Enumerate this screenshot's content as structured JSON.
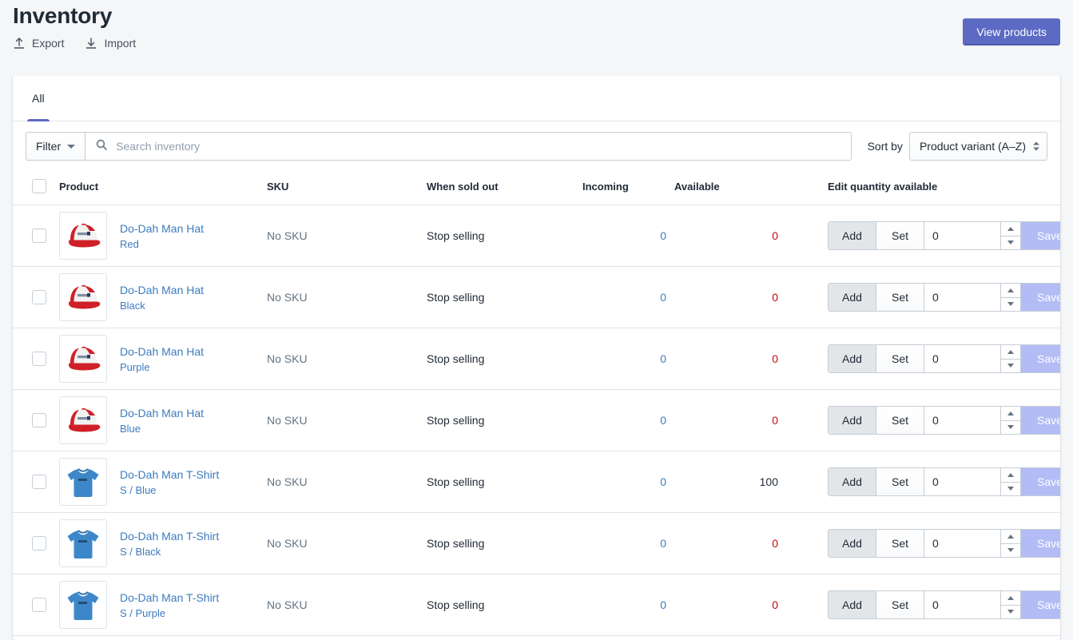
{
  "header": {
    "title": "Inventory",
    "export_label": "Export",
    "import_label": "Import",
    "export_icon": "upload-arrow-icon",
    "import_icon": "download-arrow-icon",
    "view_products_label": "View products"
  },
  "tabs": [
    {
      "label": "All",
      "active": true
    }
  ],
  "toolbar": {
    "filter_label": "Filter",
    "search_placeholder": "Search inventory",
    "search_value": "",
    "search_icon": "search-icon",
    "sort_label": "Sort by",
    "sort_value": "Product variant (A–Z)",
    "sort_options": [
      "Product variant (A–Z)"
    ]
  },
  "table": {
    "columns": [
      "",
      "Product",
      "SKU",
      "When sold out",
      "Incoming",
      "Available",
      "Edit quantity available"
    ],
    "rows": [
      {
        "selected": false,
        "thumb": "red-trucker-hat-icon",
        "product": "Do-Dah Man Hat",
        "variant": "Red",
        "sku": "No SKU",
        "when_sold_out": "Stop selling",
        "incoming": "0",
        "available": "0",
        "available_zero": true,
        "add_label": "Add",
        "set_label": "Set",
        "qty_value": "0",
        "save_label": "Save"
      },
      {
        "selected": false,
        "thumb": "red-trucker-hat-icon",
        "product": "Do-Dah Man Hat",
        "variant": "Black",
        "sku": "No SKU",
        "when_sold_out": "Stop selling",
        "incoming": "0",
        "available": "0",
        "available_zero": true,
        "add_label": "Add",
        "set_label": "Set",
        "qty_value": "0",
        "save_label": "Save"
      },
      {
        "selected": false,
        "thumb": "red-trucker-hat-icon",
        "product": "Do-Dah Man Hat",
        "variant": "Purple",
        "sku": "No SKU",
        "when_sold_out": "Stop selling",
        "incoming": "0",
        "available": "0",
        "available_zero": true,
        "add_label": "Add",
        "set_label": "Set",
        "qty_value": "0",
        "save_label": "Save"
      },
      {
        "selected": false,
        "thumb": "red-trucker-hat-icon",
        "product": "Do-Dah Man Hat",
        "variant": "Blue",
        "sku": "No SKU",
        "when_sold_out": "Stop selling",
        "incoming": "0",
        "available": "0",
        "available_zero": true,
        "add_label": "Add",
        "set_label": "Set",
        "qty_value": "0",
        "save_label": "Save"
      },
      {
        "selected": false,
        "thumb": "blue-tshirt-icon",
        "product": "Do-Dah Man T-Shirt",
        "variant": "S / Blue",
        "sku": "No SKU",
        "when_sold_out": "Stop selling",
        "incoming": "0",
        "available": "100",
        "available_zero": false,
        "add_label": "Add",
        "set_label": "Set",
        "qty_value": "0",
        "save_label": "Save"
      },
      {
        "selected": false,
        "thumb": "blue-tshirt-icon",
        "product": "Do-Dah Man T-Shirt",
        "variant": "S / Black",
        "sku": "No SKU",
        "when_sold_out": "Stop selling",
        "incoming": "0",
        "available": "0",
        "available_zero": true,
        "add_label": "Add",
        "set_label": "Set",
        "qty_value": "0",
        "save_label": "Save"
      },
      {
        "selected": false,
        "thumb": "blue-tshirt-icon",
        "product": "Do-Dah Man T-Shirt",
        "variant": "S / Purple",
        "sku": "No SKU",
        "when_sold_out": "Stop selling",
        "incoming": "0",
        "available": "0",
        "available_zero": true,
        "add_label": "Add",
        "set_label": "Set",
        "qty_value": "0",
        "save_label": "Save"
      }
    ]
  },
  "colors": {
    "accent": "#5c6ac4",
    "link": "#3d7bbf",
    "danger": "#bf0711",
    "save_disabled": "#b3bcf5",
    "page_bg": "#f4f6f8",
    "border": "#dfe3e8"
  }
}
